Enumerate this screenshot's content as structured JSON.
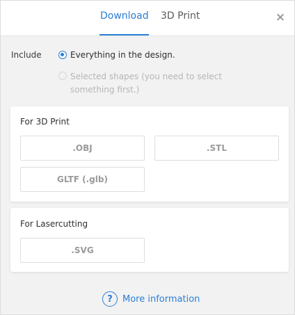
{
  "header": {
    "tabs": [
      {
        "label": "Download",
        "active": true
      },
      {
        "label": "3D Print",
        "active": false
      }
    ],
    "close_icon": "×"
  },
  "include": {
    "label": "Include",
    "options": [
      {
        "label": "Everything in the design.",
        "selected": true,
        "enabled": true
      },
      {
        "label": "Selected shapes (you need to select something first.)",
        "selected": false,
        "enabled": false
      }
    ]
  },
  "sections": [
    {
      "title": "For 3D Print",
      "buttons": [
        ".OBJ",
        ".STL",
        "GLTF (.glb)"
      ]
    },
    {
      "title": "For Lasercutting",
      "buttons": [
        ".SVG"
      ]
    }
  ],
  "footer": {
    "help_icon": "?",
    "more_info_label": "More information"
  },
  "colors": {
    "accent": "#2a7fd4",
    "background": "#f2f2f2",
    "card": "#ffffff",
    "disabled_text": "#b6b6b6"
  }
}
